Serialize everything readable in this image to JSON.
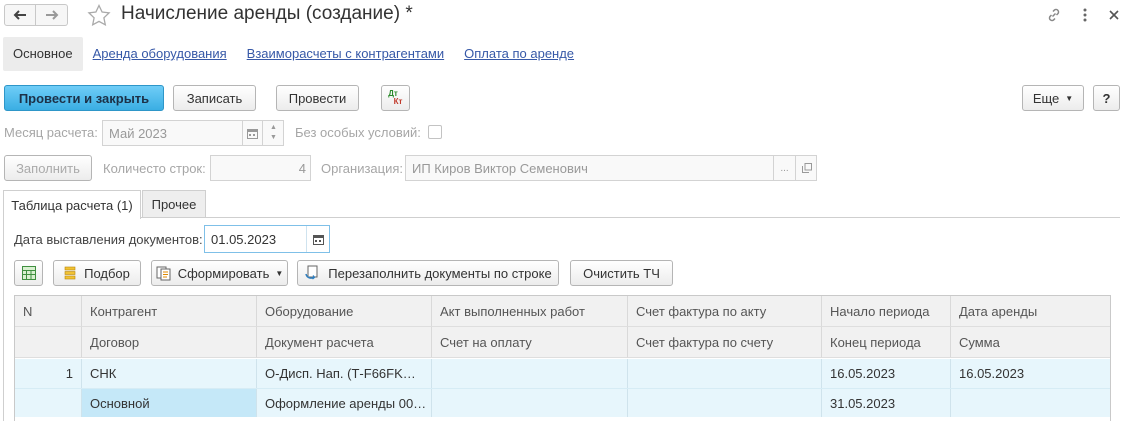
{
  "window": {
    "title": "Начисление аренды (создание) *"
  },
  "sections": [
    {
      "label": "Основное"
    },
    {
      "label": "Аренда оборудования"
    },
    {
      "label": "Взаиморасчеты с контрагентами"
    },
    {
      "label": "Оплата по аренде"
    }
  ],
  "toolbar": {
    "post_close": "Провести и закрыть",
    "save": "Записать",
    "post": "Провести",
    "dtkt_top": "Дт",
    "dtkt_bottom": "Кт",
    "more": "Еще",
    "help": "?"
  },
  "form": {
    "month_label": "Месяц расчета:",
    "month_value": "Май 2023",
    "special_label": "Без особых условий:",
    "fill_button": "Заполнить",
    "rows_label": "Количесто строк:",
    "rows_value": "4",
    "org_label": "Организация:",
    "org_value": "ИП Киров Виктор Семенович",
    "org_select": "..."
  },
  "tabs": [
    {
      "label": "Таблица расчета (1)"
    },
    {
      "label": "Прочее"
    }
  ],
  "calc": {
    "date_label": "Дата выставления документов:",
    "date_value": "01.05.2023",
    "pick_button": "Подбор",
    "form_button": "Сформировать",
    "refill_button": "Перезаполнить документы по строке",
    "clear_button": "Очистить ТЧ"
  },
  "table": {
    "header1": [
      "N",
      "Контрагент",
      "Оборудование",
      "Акт выполненных работ",
      "Счет фактура по акту",
      "Начало периода",
      "Дата аренды"
    ],
    "header2": [
      "",
      "Договор",
      "Документ расчета",
      "Счет на оплату",
      "Счет фактура по счету",
      "Конец периода",
      "Сумма"
    ],
    "rows": [
      {
        "line1": [
          "1",
          "СНК",
          "О-Дисп. Нап.  (Т-F66FK…",
          "",
          "",
          "16.05.2023",
          "16.05.2023"
        ],
        "line2": [
          "",
          "Основной",
          "Оформление аренды 00…",
          "",
          "",
          "31.05.2023",
          ""
        ]
      }
    ]
  },
  "colors": {
    "primary": "#3aaee3",
    "link": "#3658a7",
    "row_highlight": "#e7f6fc",
    "cell_selected": "#c5e8f8"
  }
}
